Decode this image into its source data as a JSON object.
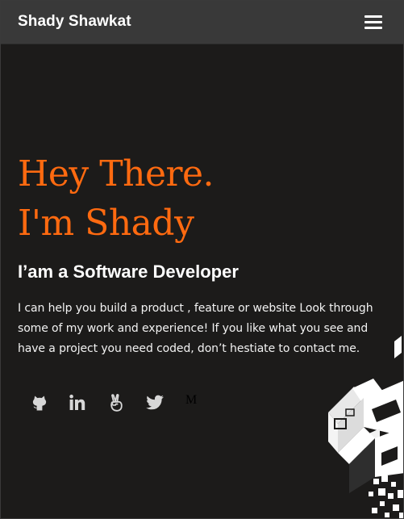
{
  "navbar": {
    "brand": "Shady Shawkat",
    "menu_icon": "hamburger-menu-icon"
  },
  "hero": {
    "title_line1": "Hey There.",
    "title_line2": "I'm Shady",
    "subtitle": "I’am a Software Developer",
    "description": "I can help you build a product , feature or website Look through some of my work and experience! If you like what you see and have a project you need coded, don’t hestiate to contact me."
  },
  "social": [
    {
      "icon": "github-icon"
    },
    {
      "icon": "linkedin-icon"
    },
    {
      "icon": "angellist-icon"
    },
    {
      "icon": "twitter-icon"
    },
    {
      "icon": "medium-icon",
      "glyph": "M"
    }
  ],
  "colors": {
    "background": "#1c1b1a",
    "navbar": "#393939",
    "accent": "#ff6a10",
    "text": "#ffffff",
    "icon": "#d7d7d7"
  }
}
